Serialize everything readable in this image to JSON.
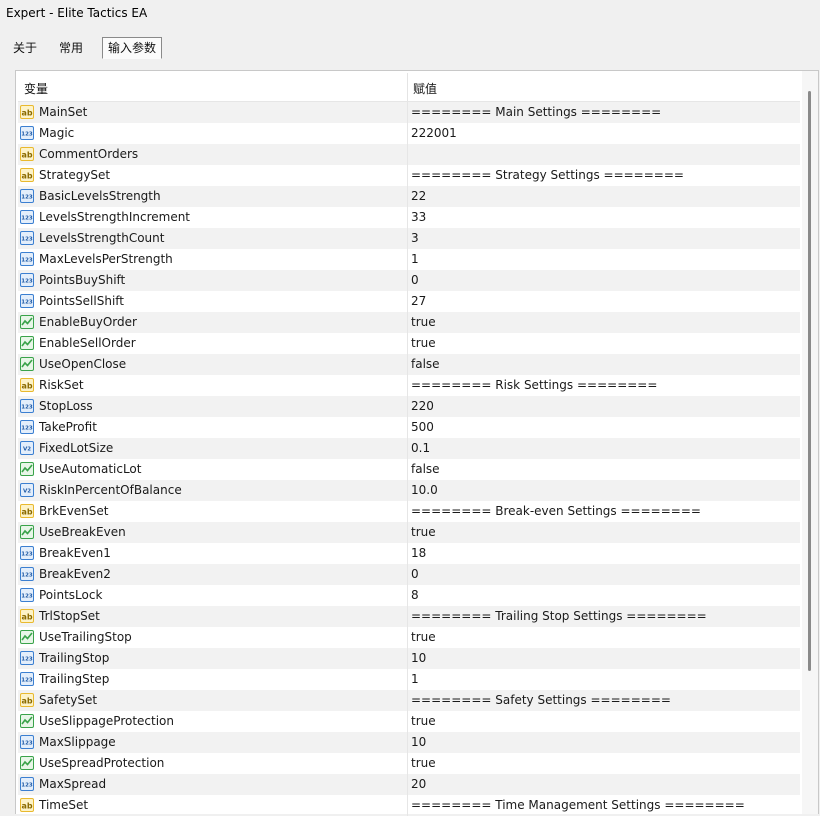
{
  "window": {
    "title": "Expert - Elite Tactics EA"
  },
  "tabs": [
    {
      "label": "关于"
    },
    {
      "label": "常用"
    },
    {
      "label": "输入参数"
    }
  ],
  "table": {
    "headers": {
      "variable": "变量",
      "value": "赋值"
    },
    "rows": [
      {
        "type": "string",
        "name": "MainSet",
        "value": "======== Main Settings ========"
      },
      {
        "type": "int",
        "name": "Magic",
        "value": "222001"
      },
      {
        "type": "string",
        "name": "CommentOrders",
        "value": ""
      },
      {
        "type": "string",
        "name": "StrategySet",
        "value": "======== Strategy Settings ========"
      },
      {
        "type": "int",
        "name": "BasicLevelsStrength",
        "value": "22"
      },
      {
        "type": "int",
        "name": "LevelsStrengthIncrement",
        "value": "33"
      },
      {
        "type": "int",
        "name": "LevelsStrengthCount",
        "value": "3"
      },
      {
        "type": "int",
        "name": "MaxLevelsPerStrength",
        "value": "1"
      },
      {
        "type": "int",
        "name": "PointsBuyShift",
        "value": "0"
      },
      {
        "type": "int",
        "name": "PointsSellShift",
        "value": "27"
      },
      {
        "type": "bool",
        "name": "EnableBuyOrder",
        "value": "true"
      },
      {
        "type": "bool",
        "name": "EnableSellOrder",
        "value": "true"
      },
      {
        "type": "bool",
        "name": "UseOpenClose",
        "value": "false"
      },
      {
        "type": "string",
        "name": "RiskSet",
        "value": "======== Risk Settings ========"
      },
      {
        "type": "int",
        "name": "StopLoss",
        "value": "220"
      },
      {
        "type": "int",
        "name": "TakeProfit",
        "value": "500"
      },
      {
        "type": "double",
        "name": "FixedLotSize",
        "value": "0.1"
      },
      {
        "type": "bool",
        "name": "UseAutomaticLot",
        "value": "false"
      },
      {
        "type": "double",
        "name": "RiskInPercentOfBalance",
        "value": "10.0"
      },
      {
        "type": "string",
        "name": "BrkEvenSet",
        "value": "======== Break-even Settings ========"
      },
      {
        "type": "bool",
        "name": "UseBreakEven",
        "value": "true"
      },
      {
        "type": "int",
        "name": "BreakEven1",
        "value": "18"
      },
      {
        "type": "int",
        "name": "BreakEven2",
        "value": "0"
      },
      {
        "type": "int",
        "name": "PointsLock",
        "value": "8"
      },
      {
        "type": "string",
        "name": "TrlStopSet",
        "value": "======== Trailing Stop Settings ========"
      },
      {
        "type": "bool",
        "name": "UseTrailingStop",
        "value": "true"
      },
      {
        "type": "int",
        "name": "TrailingStop",
        "value": "10"
      },
      {
        "type": "int",
        "name": "TrailingStep",
        "value": "1"
      },
      {
        "type": "string",
        "name": "SafetySet",
        "value": "======== Safety Settings ========"
      },
      {
        "type": "bool",
        "name": "UseSlippageProtection",
        "value": "true"
      },
      {
        "type": "int",
        "name": "MaxSlippage",
        "value": "10"
      },
      {
        "type": "bool",
        "name": "UseSpreadProtection",
        "value": "true"
      },
      {
        "type": "int",
        "name": "MaxSpread",
        "value": "20"
      },
      {
        "type": "string",
        "name": "TimeSet",
        "value": "======== Time Management Settings ========"
      }
    ]
  },
  "icons": {
    "string": {
      "label": "ab",
      "name": "string-type-icon",
      "color": "#e9b92e"
    },
    "int": {
      "label": "123",
      "name": "integer-type-icon",
      "color": "#3b7fd1"
    },
    "double": {
      "label": "V2",
      "name": "double-type-icon",
      "color": "#3b7fd1"
    },
    "bool": {
      "label": "",
      "name": "boolean-type-icon",
      "color": "#3aa34a"
    }
  }
}
